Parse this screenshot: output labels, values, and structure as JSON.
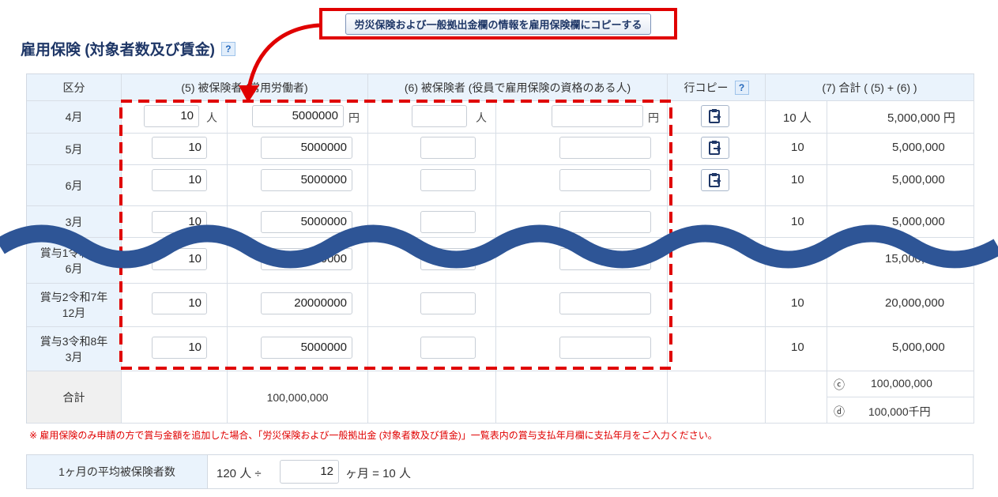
{
  "title": "雇用保険 (対象者数及び賃金)",
  "help_label": "?",
  "copy_button_label": "労災保険および一般拠出金欄の情報を雇用保険欄にコピーする",
  "headers": {
    "kubun": "区分",
    "col5": "(5) 被保険者 (常用労働者)",
    "col6": "(6) 被保険者 (役員で雇用保険の資格のある人)",
    "row_copy": "行コピー",
    "col7": "(7) 合計 ( (5) + (6) )"
  },
  "units": {
    "person": "人",
    "yen": "円"
  },
  "rows": [
    {
      "label": "4月",
      "count": "10",
      "wage": "5000000",
      "count6": "",
      "wage6": "",
      "total_count": "10 人",
      "total_wage": "5,000,000 円"
    },
    {
      "label": "5月",
      "count": "10",
      "wage": "5000000",
      "count6": "",
      "wage6": "",
      "total_count": "10",
      "total_wage": "5,000,000"
    },
    {
      "label": "6月",
      "count": "10",
      "wage": "5000000",
      "count6": "",
      "wage6": "",
      "total_count": "10",
      "total_wage": "5,000,000"
    },
    {
      "label": "3月",
      "count": "10",
      "wage": "5000000",
      "count6": "",
      "wage6": "",
      "total_count": "10",
      "total_wage": "5,000,000"
    },
    {
      "label": "賞与1令和7年\n6月",
      "count": "10",
      "wage": "15000000",
      "count6": "",
      "wage6": "",
      "total_count": "10",
      "total_wage": "15,000,000"
    },
    {
      "label": "賞与2令和7年\n12月",
      "count": "10",
      "wage": "20000000",
      "count6": "",
      "wage6": "",
      "total_count": "10",
      "total_wage": "20,000,000"
    },
    {
      "label": "賞与3令和8年\n3月",
      "count": "10",
      "wage": "5000000",
      "count6": "",
      "wage6": "",
      "total_count": "10",
      "total_wage": "5,000,000"
    }
  ],
  "sum": {
    "label": "合計",
    "wage_total": "100,000,000",
    "c_mark": "ⓒ",
    "c_value": "100,000,000",
    "d_mark": "ⓓ",
    "d_value": "100,000千円"
  },
  "note": "※ 雇用保険のみ申請の方で賞与金額を追加した場合、「労災保険および一般拠出金 (対象者数及び賃金)」一覧表内の賞与支払年月欄に支払年月をご入力ください。",
  "average": {
    "label": "1ヶ月の平均被保険者数",
    "total": "120 人 ÷",
    "months": "12",
    "result": "ヶ月 = 10 人"
  },
  "colors": {
    "accent_red": "#e00000",
    "wave_blue": "#2e5596",
    "header_bg": "#eaf3fc"
  },
  "icons": {
    "row_copy": "clipboard-copy-icon",
    "help": "help-icon"
  }
}
